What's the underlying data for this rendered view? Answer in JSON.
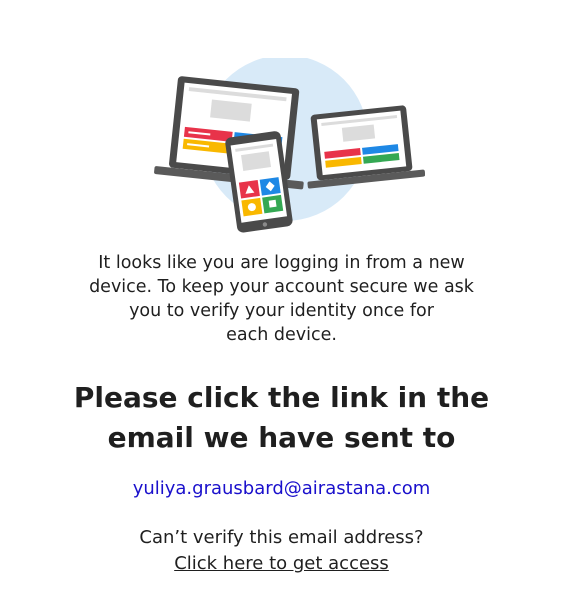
{
  "illustration": {
    "icon": "devices-illustration-icon",
    "colors": {
      "circle": "#d8eaf8",
      "device_frame": "#4a4a4a",
      "screen": "#ffffff",
      "placeholder": "#dcdcdc",
      "red": "#e8334a",
      "blue": "#1e88e5",
      "yellow": "#f9b800",
      "green": "#34a853"
    }
  },
  "message": {
    "line1": "It looks like you are logging in from a new",
    "line2": "device. To keep your account secure we ask",
    "line3": "you to verify your identity once for",
    "line4": "each device."
  },
  "headline": {
    "line1": "Please click the link in the",
    "line2": "email we have sent to"
  },
  "email": "yuliya.grausbard@airastana.com",
  "help": {
    "question": "Can’t verify this email address?",
    "link_label": "Click here to get access"
  }
}
